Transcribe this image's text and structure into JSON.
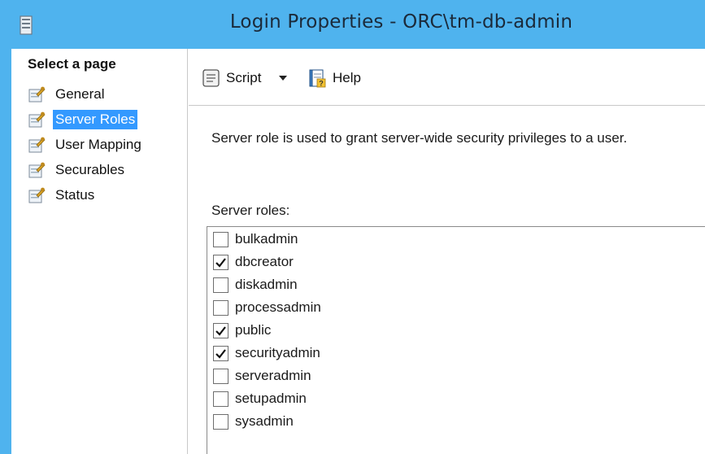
{
  "window": {
    "title": "Login Properties - ORC\\tm-db-admin",
    "accent_color": "#4fb3ee"
  },
  "nav": {
    "header": "Select a page",
    "items": [
      {
        "label": "General",
        "icon": "page-wrench-icon",
        "selected": false
      },
      {
        "label": "Server Roles",
        "icon": "page-wrench-icon",
        "selected": true
      },
      {
        "label": "User Mapping",
        "icon": "page-wrench-icon",
        "selected": false
      },
      {
        "label": "Securables",
        "icon": "page-wrench-icon",
        "selected": false
      },
      {
        "label": "Status",
        "icon": "page-wrench-icon",
        "selected": false
      }
    ],
    "selected_color": "#3399ff"
  },
  "toolbar": {
    "script_label": "Script",
    "script_icon": "script-scroll-icon",
    "dropdown_icon": "caret-down-icon",
    "help_label": "Help",
    "help_icon": "help-book-icon"
  },
  "main": {
    "description": "Server role is used to grant server-wide security privileges to a user.",
    "roles_label": "Server roles:",
    "roles": [
      {
        "name": "bulkadmin",
        "checked": false
      },
      {
        "name": "dbcreator",
        "checked": true
      },
      {
        "name": "diskadmin",
        "checked": false
      },
      {
        "name": "processadmin",
        "checked": false
      },
      {
        "name": "public",
        "checked": true
      },
      {
        "name": "securityadmin",
        "checked": true
      },
      {
        "name": "serveradmin",
        "checked": false
      },
      {
        "name": "setupadmin",
        "checked": false
      },
      {
        "name": "sysadmin",
        "checked": false
      }
    ]
  }
}
